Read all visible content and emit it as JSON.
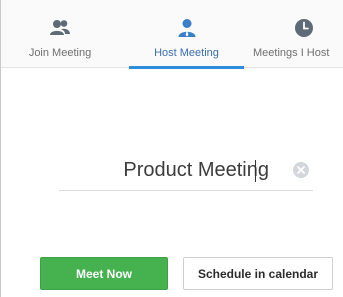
{
  "tabs": {
    "join": {
      "label": "Join Meeting",
      "icon": "people-icon"
    },
    "host": {
      "label": "Host Meeting",
      "icon": "person-icon"
    },
    "meetings": {
      "label": "Meetings I Host",
      "icon": "clock-icon"
    },
    "active": "host"
  },
  "meeting": {
    "topic_value": "Product Meeting",
    "clear_icon": "clear-icon"
  },
  "actions": {
    "meet_now_label": "Meet Now",
    "schedule_label": "Schedule in calendar"
  },
  "colors": {
    "accent_blue": "#2d8cdb",
    "active_icon_blue": "#3a7fc8",
    "inactive_icon": "#5e6a76",
    "primary_green": "#45b14f"
  }
}
